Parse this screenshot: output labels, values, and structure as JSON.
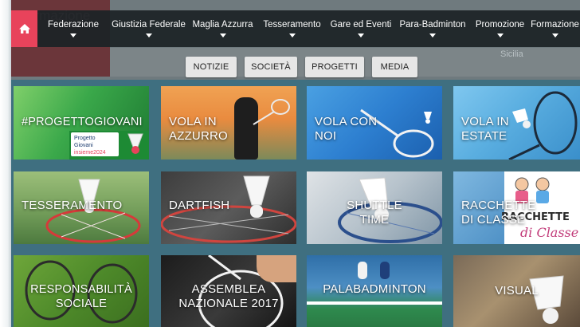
{
  "backdrop": {
    "ghost_title": "ormazione",
    "ghost_sub": "Sicilia"
  },
  "nav": {
    "home_icon": "home-icon",
    "items": [
      {
        "label": "Federazione"
      },
      {
        "label": "Giustizia Federale"
      },
      {
        "label": "Maglia Azzurra"
      },
      {
        "label": "Tesseramento"
      },
      {
        "label": "Gare ed Eventi"
      },
      {
        "label": "Para-Badminton"
      },
      {
        "label": "Promozione"
      },
      {
        "label": "Formazione"
      }
    ],
    "accent": "#e8435b"
  },
  "subnav": {
    "buttons": [
      "NOTIZIE",
      "SOCIETÀ",
      "PROGETTI",
      "MEDIA"
    ]
  },
  "tiles": [
    {
      "label": "#PROGETTOGIOVANI",
      "badge": "Progetto Giovani",
      "badge_sub": "insieme2024"
    },
    {
      "label_lines": [
        "VOLA IN",
        "AZZURRO"
      ]
    },
    {
      "label_lines": [
        "VOLA CON",
        "NOI"
      ]
    },
    {
      "label_lines": [
        "VOLA IN",
        "ESTATE"
      ]
    },
    {
      "label": "TESSERAMENTO"
    },
    {
      "label": "DARTFISH"
    },
    {
      "label_lines": [
        "SHUTTLE",
        "TIME"
      ]
    },
    {
      "label_lines": [
        "RACCHETTE",
        "DI CLASSE"
      ],
      "logo_line1": "RACCHETTE",
      "logo_line2": "di Classe"
    },
    {
      "label_lines": [
        "RESPONSABILITÀ",
        "SOCIALE"
      ]
    },
    {
      "label_lines": [
        "ASSEMBLEA",
        "NAZIONALE 2017"
      ]
    },
    {
      "label": "PALABADMINTON"
    },
    {
      "label": "VISUAL"
    }
  ]
}
